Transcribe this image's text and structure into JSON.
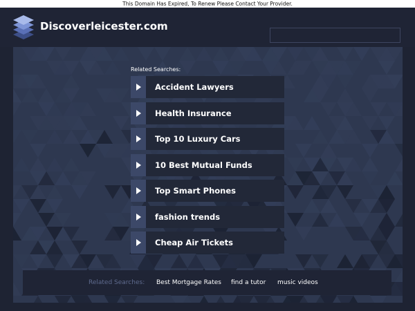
{
  "notice": "This Domain Has Expired, To Renew Please Contact Your Provider.",
  "header": {
    "site_name": "Discoverleicester.com",
    "logo_icon": "stacked-layers-icon",
    "search_value": ""
  },
  "related": {
    "label": "Related Searches:",
    "items": [
      {
        "label": "Accident Lawyers"
      },
      {
        "label": "Health Insurance"
      },
      {
        "label": "Top 10 Luxury Cars"
      },
      {
        "label": "10 Best Mutual Funds"
      },
      {
        "label": "Top Smart Phones"
      },
      {
        "label": "fashion trends"
      },
      {
        "label": "Cheap Air Tickets"
      }
    ]
  },
  "footer": {
    "label": "Related Searches:",
    "links": [
      {
        "label": "Best Mortgage Rates"
      },
      {
        "label": "find a tutor"
      },
      {
        "label": "music videos"
      }
    ]
  },
  "colors": {
    "background": "#1e2333",
    "panel": "#2e3850",
    "link_bg": "#222838",
    "arrow_bg": "#3c4868",
    "muted_text": "#5f6b8e"
  }
}
